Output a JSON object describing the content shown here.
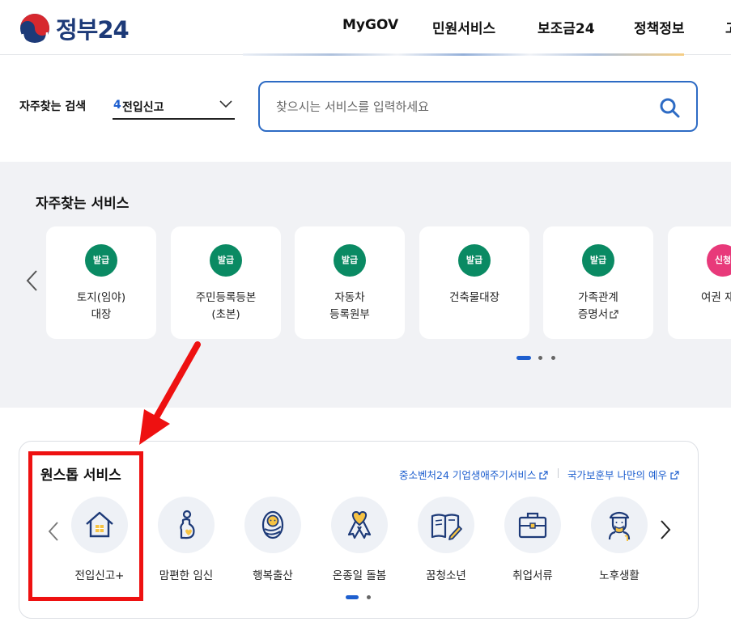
{
  "header": {
    "logo_text": "정부24",
    "nav": [
      {
        "label": "MyGOV"
      },
      {
        "label": "민원서비스"
      },
      {
        "label": "보조금24"
      },
      {
        "label": "정책정보"
      },
      {
        "label": "고"
      }
    ]
  },
  "search": {
    "label": "자주찾는 검색",
    "selected_rank": "4",
    "selected_value": "전입신고",
    "placeholder": "찾으시는 서비스를 입력하세요"
  },
  "frequent": {
    "title": "자주찾는 서비스",
    "cards": [
      {
        "badge": "발급",
        "label": "토지(임야)\n대장"
      },
      {
        "badge": "발급",
        "label": "주민등록등본\n(초본)"
      },
      {
        "badge": "발급",
        "label": "자동차\n등록원부"
      },
      {
        "badge": "발급",
        "label": "건축물대장"
      },
      {
        "badge": "발급",
        "label": "가족관계\n증명서"
      },
      {
        "badge": "신청",
        "label": "여권 재발"
      }
    ],
    "pager": {
      "current": 1,
      "total": 3
    }
  },
  "onestop": {
    "title": "원스톱 서비스",
    "links": [
      {
        "label": "중소벤처24 기업생애주기서비스"
      },
      {
        "label": "국가보훈부 나만의 예우"
      }
    ],
    "items": [
      {
        "label": "전입신고+",
        "icon": "house-icon"
      },
      {
        "label": "맘편한 임신",
        "icon": "pregnancy-icon"
      },
      {
        "label": "행복출산",
        "icon": "baby-icon"
      },
      {
        "label": "온종일 돌봄",
        "icon": "ribbon-heart-icon"
      },
      {
        "label": "꿈청소년",
        "icon": "book-pen-icon"
      },
      {
        "label": "취업서류",
        "icon": "briefcase-icon"
      },
      {
        "label": "노후생활",
        "icon": "elderly-icon"
      }
    ],
    "pager": {
      "current": 1,
      "total": 2
    }
  },
  "annotation": {
    "color": "#ee1111",
    "target": "전입신고+"
  },
  "colors": {
    "primary_blue": "#1e5fcf",
    "badge_green": "#0a8a63",
    "badge_pink": "#e8397a",
    "section_bg": "#f1f2f5",
    "icon_navy": "#1d3a78",
    "icon_yellow": "#f6c343"
  }
}
